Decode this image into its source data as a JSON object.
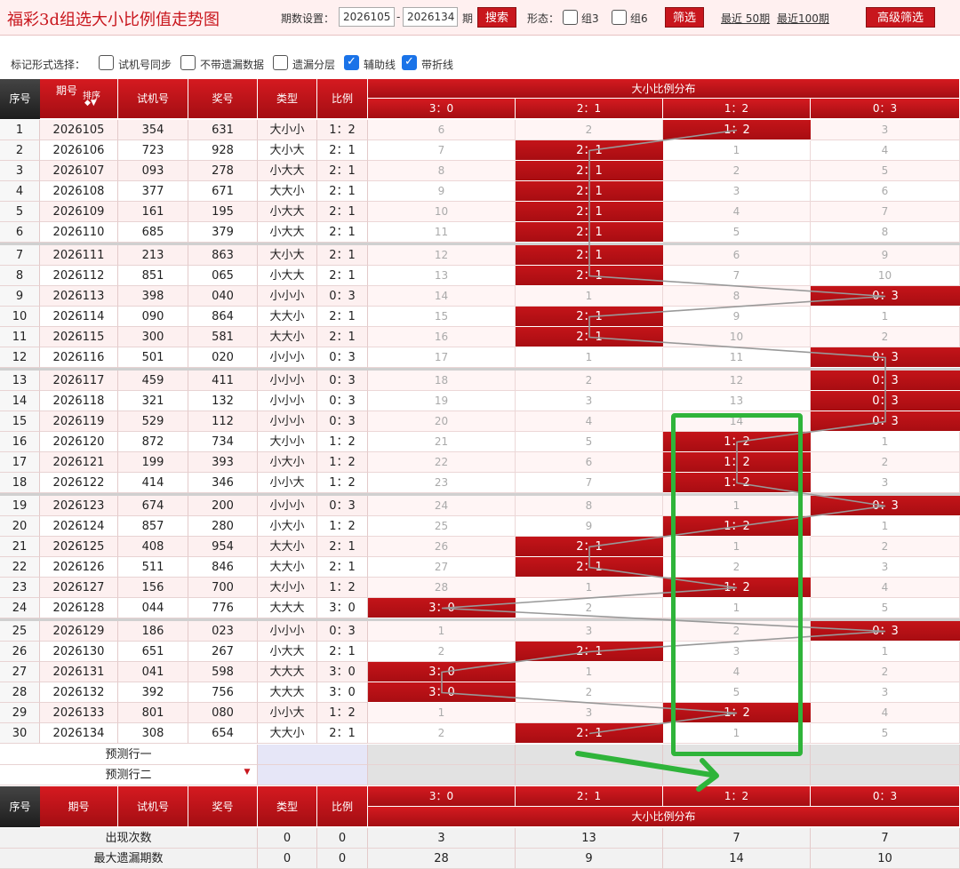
{
  "title": "福彩3d组选大小比例值走势图",
  "toolbar": {
    "period_label": "期数设置：",
    "from": "2026105",
    "dash": "-",
    "to": "2026134",
    "period_suffix": "期",
    "search": "搜索",
    "form_label": "形态：",
    "zu3": "组3",
    "zu6": "组6",
    "filter": "筛选",
    "recent50": "最近 50期",
    "recent100": "最近100期",
    "advanced": "高级筛选"
  },
  "marks": {
    "label": "标记形式选择：",
    "opts": [
      {
        "label": "试机号同步",
        "checked": false
      },
      {
        "label": "不带遗漏数据",
        "checked": false
      },
      {
        "label": "遗漏分层",
        "checked": false
      },
      {
        "label": "辅助线",
        "checked": true
      },
      {
        "label": "带折线",
        "checked": true
      }
    ]
  },
  "header": {
    "seq": "序号",
    "period": "期号",
    "sort": "排序",
    "test": "试机号",
    "draw": "奖号",
    "type": "类型",
    "ratio": "比例",
    "dist": "大小比例分布",
    "cols": [
      "3：0",
      "2：1",
      "1：2",
      "0：3"
    ]
  },
  "rows": [
    [
      "1",
      "2026105",
      "354",
      "631",
      "大小小",
      "1：2",
      2,
      [
        6,
        2,
        0,
        3
      ]
    ],
    [
      "2",
      "2026106",
      "723",
      "928",
      "大小大",
      "2：1",
      1,
      [
        7,
        0,
        1,
        4
      ]
    ],
    [
      "3",
      "2026107",
      "093",
      "278",
      "小大大",
      "2：1",
      1,
      [
        8,
        0,
        2,
        5
      ]
    ],
    [
      "4",
      "2026108",
      "377",
      "671",
      "大大小",
      "2：1",
      1,
      [
        9,
        0,
        3,
        6
      ]
    ],
    [
      "5",
      "2026109",
      "161",
      "195",
      "小大大",
      "2：1",
      1,
      [
        10,
        0,
        4,
        7
      ]
    ],
    [
      "6",
      "2026110",
      "685",
      "379",
      "小大大",
      "2：1",
      1,
      [
        11,
        0,
        5,
        8
      ]
    ],
    [
      "7",
      "2026111",
      "213",
      "863",
      "大小大",
      "2：1",
      1,
      [
        12,
        0,
        6,
        9
      ]
    ],
    [
      "8",
      "2026112",
      "851",
      "065",
      "小大大",
      "2：1",
      1,
      [
        13,
        0,
        7,
        10
      ]
    ],
    [
      "9",
      "2026113",
      "398",
      "040",
      "小小小",
      "0：3",
      3,
      [
        14,
        1,
        8,
        0
      ]
    ],
    [
      "10",
      "2026114",
      "090",
      "864",
      "大大小",
      "2：1",
      1,
      [
        15,
        0,
        9,
        1
      ]
    ],
    [
      "11",
      "2026115",
      "300",
      "581",
      "大大小",
      "2：1",
      1,
      [
        16,
        0,
        10,
        2
      ]
    ],
    [
      "12",
      "2026116",
      "501",
      "020",
      "小小小",
      "0：3",
      3,
      [
        17,
        1,
        11,
        0
      ]
    ],
    [
      "13",
      "2026117",
      "459",
      "411",
      "小小小",
      "0：3",
      3,
      [
        18,
        2,
        12,
        0
      ]
    ],
    [
      "14",
      "2026118",
      "321",
      "132",
      "小小小",
      "0：3",
      3,
      [
        19,
        3,
        13,
        0
      ]
    ],
    [
      "15",
      "2026119",
      "529",
      "112",
      "小小小",
      "0：3",
      3,
      [
        20,
        4,
        14,
        0
      ]
    ],
    [
      "16",
      "2026120",
      "872",
      "734",
      "大小小",
      "1：2",
      2,
      [
        21,
        5,
        0,
        1
      ]
    ],
    [
      "17",
      "2026121",
      "199",
      "393",
      "小大小",
      "1：2",
      2,
      [
        22,
        6,
        0,
        2
      ]
    ],
    [
      "18",
      "2026122",
      "414",
      "346",
      "小小大",
      "1：2",
      2,
      [
        23,
        7,
        0,
        3
      ]
    ],
    [
      "19",
      "2026123",
      "674",
      "200",
      "小小小",
      "0：3",
      3,
      [
        24,
        8,
        1,
        0
      ]
    ],
    [
      "20",
      "2026124",
      "857",
      "280",
      "小大小",
      "1：2",
      2,
      [
        25,
        9,
        0,
        1
      ]
    ],
    [
      "21",
      "2026125",
      "408",
      "954",
      "大大小",
      "2：1",
      1,
      [
        26,
        0,
        1,
        2
      ]
    ],
    [
      "22",
      "2026126",
      "511",
      "846",
      "大大小",
      "2：1",
      1,
      [
        27,
        0,
        2,
        3
      ]
    ],
    [
      "23",
      "2026127",
      "156",
      "700",
      "大小小",
      "1：2",
      2,
      [
        28,
        1,
        0,
        4
      ]
    ],
    [
      "24",
      "2026128",
      "044",
      "776",
      "大大大",
      "3：0",
      0,
      [
        0,
        2,
        1,
        5
      ]
    ],
    [
      "25",
      "2026129",
      "186",
      "023",
      "小小小",
      "0：3",
      3,
      [
        1,
        3,
        2,
        0
      ]
    ],
    [
      "26",
      "2026130",
      "651",
      "267",
      "小大大",
      "2：1",
      1,
      [
        2,
        0,
        3,
        1
      ]
    ],
    [
      "27",
      "2026131",
      "041",
      "598",
      "大大大",
      "3：0",
      0,
      [
        0,
        1,
        4,
        2
      ]
    ],
    [
      "28",
      "2026132",
      "392",
      "756",
      "大大大",
      "3：0",
      0,
      [
        0,
        2,
        5,
        3
      ]
    ],
    [
      "29",
      "2026133",
      "801",
      "080",
      "小小大",
      "1：2",
      2,
      [
        1,
        3,
        0,
        4
      ]
    ],
    [
      "30",
      "2026134",
      "308",
      "654",
      "大大小",
      "2：1",
      1,
      [
        2,
        0,
        1,
        5
      ]
    ]
  ],
  "predict": [
    "预测行一",
    "预测行二"
  ],
  "stats": [
    {
      "label": "出现次数",
      "t": "0",
      "r": "0",
      "vals": [
        "3",
        "13",
        "7",
        "7"
      ]
    },
    {
      "label": "最大遗漏期数",
      "t": "0",
      "r": "0",
      "vals": [
        "28",
        "9",
        "14",
        "10"
      ]
    }
  ],
  "colors": {
    "red": "#c8161d",
    "highlight": "#2fb43a"
  }
}
